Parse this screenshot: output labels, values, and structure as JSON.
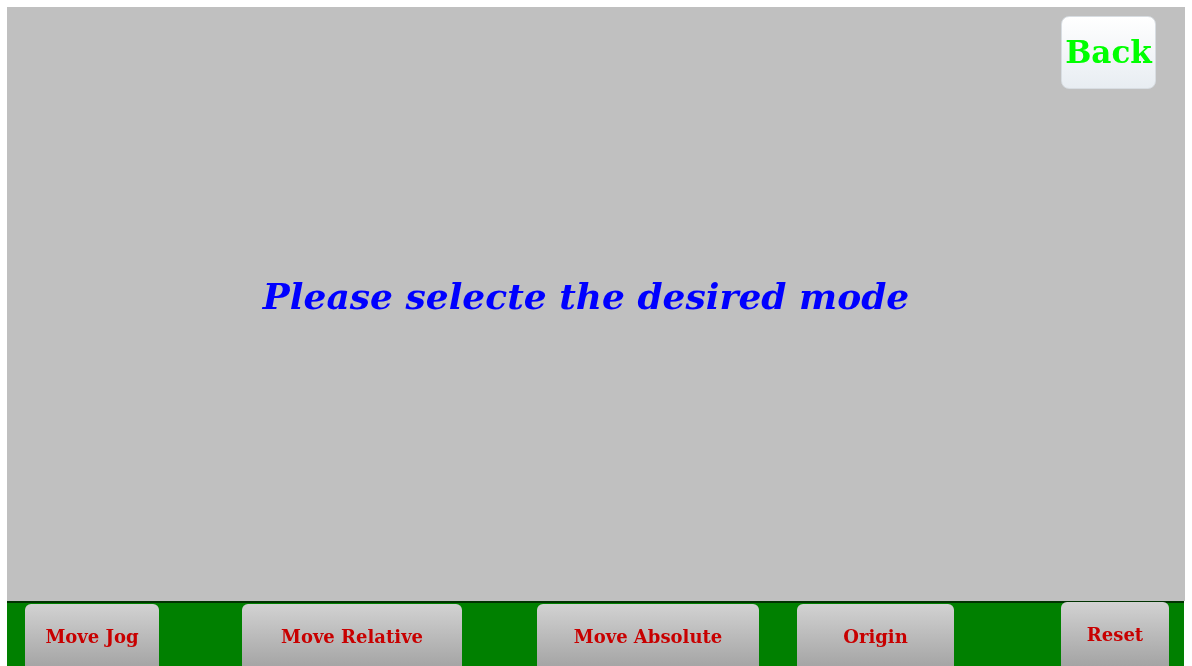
{
  "back_button": "Back",
  "prompt": "Please selecte the desired mode",
  "mode_buttons": [
    "Move Jog",
    "Move Relative",
    "Move Absolute",
    "Origin",
    "Reset"
  ]
}
